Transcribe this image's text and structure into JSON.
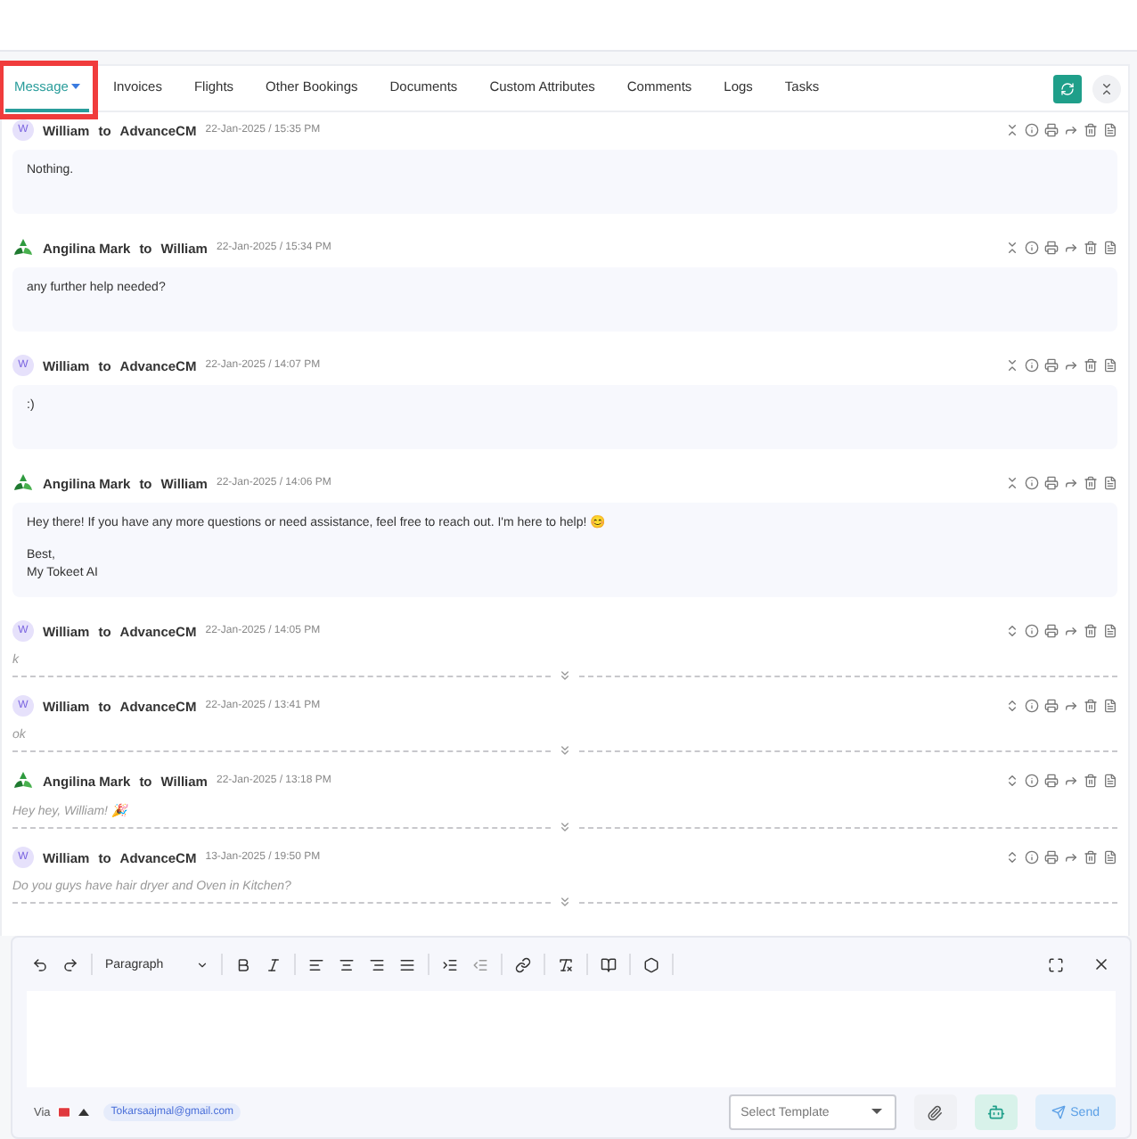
{
  "tabs": [
    {
      "label": "Message",
      "selected": true
    },
    {
      "label": "Invoices",
      "selected": false
    },
    {
      "label": "Flights",
      "selected": false
    },
    {
      "label": "Other Bookings",
      "selected": false
    },
    {
      "label": "Documents",
      "selected": false
    },
    {
      "label": "Custom Attributes",
      "selected": false
    },
    {
      "label": "Comments",
      "selected": false
    },
    {
      "label": "Logs",
      "selected": false
    },
    {
      "label": "Tasks",
      "selected": false
    }
  ],
  "messages": [
    {
      "kind": "expanded",
      "initial": "W",
      "from": "William",
      "to_word": "to",
      "to": "AdvanceCM",
      "time": "22-Jan-2025 / 15:35 PM",
      "paragraphs": [
        "Nothing."
      ]
    },
    {
      "kind": "expanded",
      "from": "Angilina Mark",
      "to_word": "to",
      "to": "William",
      "time": "22-Jan-2025 / 15:34 PM",
      "paragraphs": [
        "any further help needed?"
      ]
    },
    {
      "kind": "expanded",
      "initial": "W",
      "from": "William",
      "to_word": "to",
      "to": "AdvanceCM",
      "time": "22-Jan-2025 / 14:07 PM",
      "paragraphs": [
        ":)"
      ]
    },
    {
      "kind": "expanded",
      "from": "Angilina Mark",
      "to_word": "to",
      "to": "William",
      "time": "22-Jan-2025 / 14:06 PM",
      "paragraphs": [
        "Hey there! If you have any more questions or need assistance, feel free to reach out. I'm here to help! 😊",
        "Best,\nMy Tokeet AI"
      ]
    },
    {
      "kind": "collapsed",
      "initial": "W",
      "from": "William",
      "to_word": "to",
      "to": "AdvanceCM",
      "time": "22-Jan-2025 / 14:05 PM",
      "paragraphs": [
        "k"
      ]
    },
    {
      "kind": "collapsed",
      "initial": "W",
      "from": "William",
      "to_word": "to",
      "to": "AdvanceCM",
      "time": "22-Jan-2025 / 13:41 PM",
      "paragraphs": [
        "ok"
      ]
    },
    {
      "kind": "collapsed",
      "from": "Angilina Mark",
      "to_word": "to",
      "to": "William",
      "time": "22-Jan-2025 / 13:18 PM",
      "paragraphs": [
        "Hey hey, William! 🎉"
      ]
    },
    {
      "kind": "collapsed",
      "initial": "W",
      "from": "William",
      "to_word": "to",
      "to": "AdvanceCM",
      "time": "13-Jan-2025 / 19:50 PM",
      "paragraphs": [
        "Do you guys have hair dryer and Oven in Kitchen?"
      ]
    }
  ],
  "editor": {
    "block_format": "Paragraph",
    "via": "Via",
    "email": "Tokarsaajmal@gmail.com",
    "template": {
      "placeholder": "Select Template"
    },
    "send": "Send"
  }
}
